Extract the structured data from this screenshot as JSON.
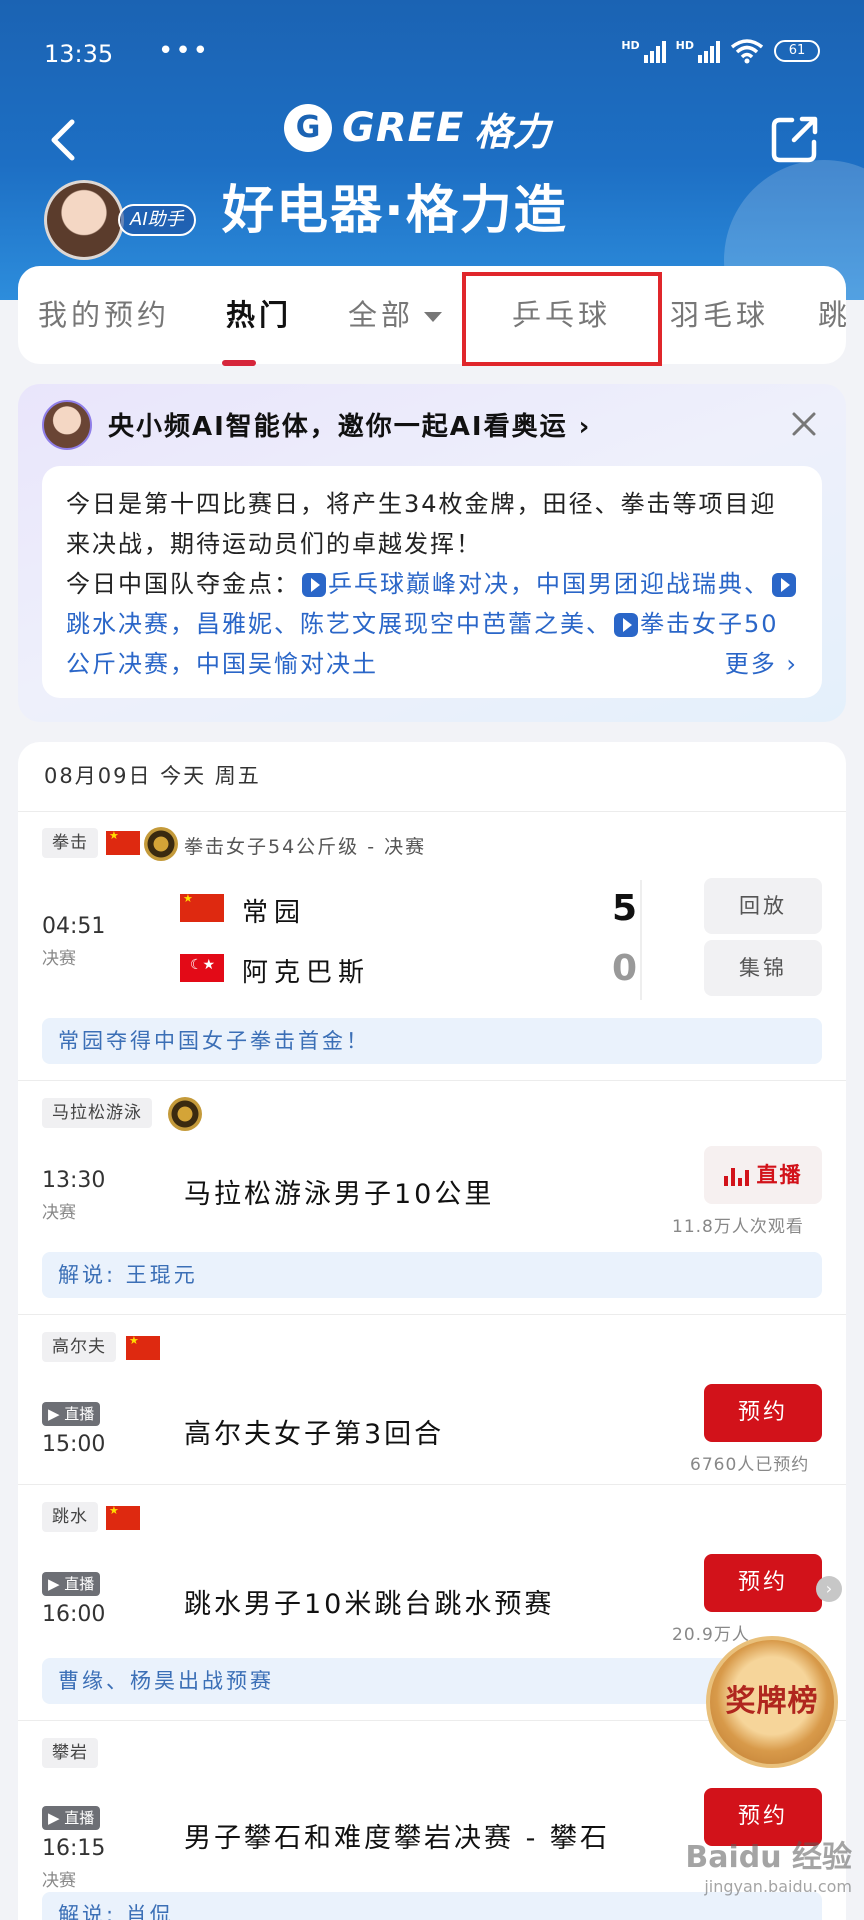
{
  "status_bar": {
    "time": "13:35",
    "dots": "•••",
    "net_tags": [
      "HD",
      "HD"
    ],
    "battery": "61"
  },
  "header": {
    "brand_mark": "G",
    "brand_word": "GREE",
    "brand_cn": "格力",
    "slogan": "好电器·格力造",
    "ai_badge": "AI助手"
  },
  "tabs": {
    "items": [
      "我的预约",
      "热门",
      "全部",
      "乒乓球",
      "羽毛球",
      "跳"
    ],
    "active": "热门",
    "highlighted": "乒乓球"
  },
  "ai_panel": {
    "title": "央小频AI智能体，邀你一起AI看奥运 ›",
    "line1": "今日是第十四比赛日，将产生34枚金牌，田径、拳击等项目迎来决战，期待运动员们的卓越发挥！",
    "line2_prefix": "今日中国队夺金点：",
    "highlight1": "乒乓球巅峰对决，中国男团迎战瑞典、",
    "highlight2": "跳水决赛，昌雅妮、陈艺文展现空中芭蕾之美、",
    "highlight3": "拳击女子50公斤决赛，中国吴愉对决土",
    "more": "更多 ›"
  },
  "schedule": {
    "date": "08月09日  今天  周五",
    "events": [
      {
        "tag": "拳击",
        "subtitle": "拳击女子54公斤级 - 决赛",
        "time": "04:51",
        "phase": "决赛",
        "players": [
          {
            "name": "常园",
            "score": "5"
          },
          {
            "name": "阿克巴斯",
            "score": "0"
          }
        ],
        "buttons": [
          "回放",
          "集锦"
        ],
        "note": "常园夺得中国女子拳击首金！"
      },
      {
        "tag": "马拉松游泳",
        "time": "13:30",
        "phase": "决赛",
        "title": "马拉松游泳男子10公里",
        "button": "直播",
        "count": "11.8万人次观看",
        "note": "解说: 王琨元"
      },
      {
        "tag": "高尔夫",
        "live_tag": "▶ 直播",
        "time": "15:00",
        "title": "高尔夫女子第3回合",
        "button": "预约",
        "count": "6760人已预约"
      },
      {
        "tag": "跳水",
        "live_tag": "▶ 直播",
        "time": "16:00",
        "title": "跳水男子10米跳台跳水预赛",
        "button": "预约",
        "count": "20.9万人",
        "note": "曹缘、杨昊出战预赛"
      },
      {
        "tag": "攀岩",
        "live_tag": "▶ 直播",
        "time": "16:15",
        "phase": "决赛",
        "title": "男子攀石和难度攀岩决赛 - 攀石",
        "button": "预约",
        "note": "解说: 肖侃"
      }
    ]
  },
  "floating": {
    "medal_board": "奖牌榜",
    "arrow": "›"
  },
  "watermark": {
    "brand": "Baidu 经验",
    "url": "jingyan.baidu.com"
  },
  "colors": {
    "header_blue": "#1b63b3",
    "accent_red": "#d2121a",
    "link_blue": "#2a66c8"
  }
}
